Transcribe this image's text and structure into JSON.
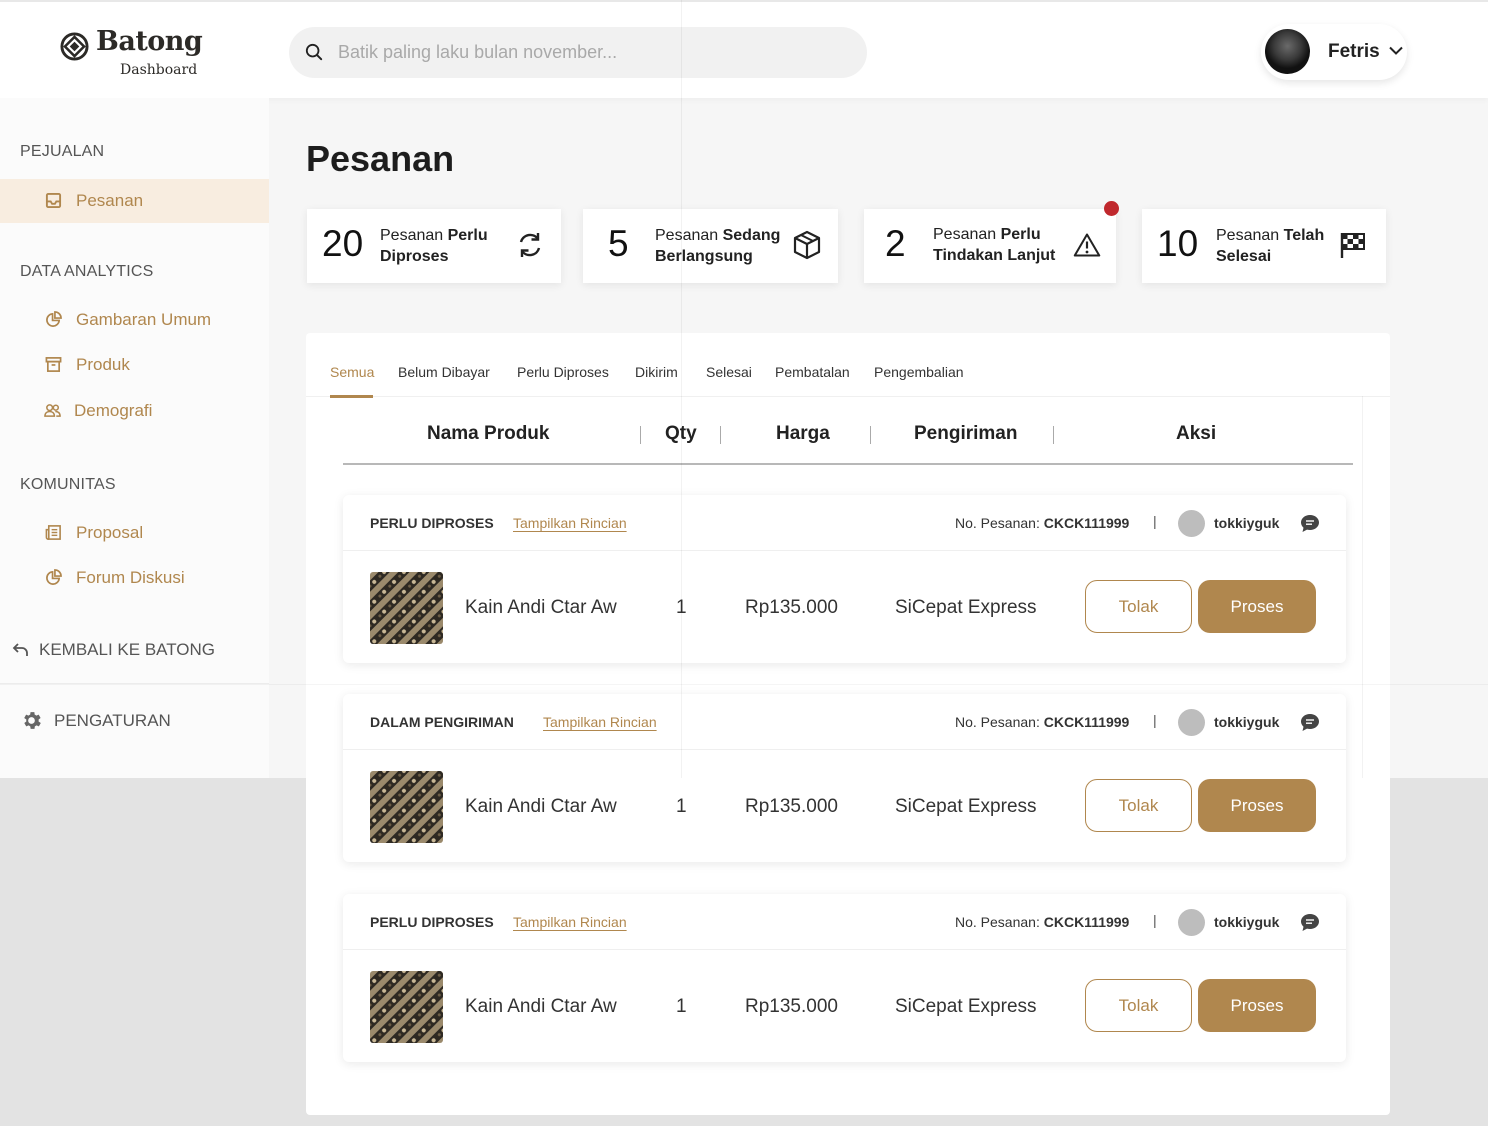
{
  "brand": {
    "name": "Batong",
    "subtitle": "Dashboard"
  },
  "search": {
    "placeholder": "Batik paling laku bulan november...",
    "value": ""
  },
  "user": {
    "name": "Fetris"
  },
  "sidebar": {
    "sections": [
      {
        "title": "PEJUALAN",
        "items": [
          {
            "label": "Pesanan",
            "icon": "inbox-icon",
            "active": true
          }
        ]
      },
      {
        "title": "DATA ANALYTICS",
        "items": [
          {
            "label": "Gambaran Umum",
            "icon": "pie-chart-icon"
          },
          {
            "label": "Produk",
            "icon": "archive-icon"
          },
          {
            "label": "Demografi",
            "icon": "users-icon"
          }
        ]
      },
      {
        "title": "KOMUNITAS",
        "items": [
          {
            "label": "Proposal",
            "icon": "newspaper-icon"
          },
          {
            "label": "Forum Diskusi",
            "icon": "pie-chart-icon"
          }
        ]
      }
    ],
    "back_label": "KEMBALI KE BATONG",
    "settings_label": "PENGATURAN"
  },
  "page": {
    "title": "Pesanan"
  },
  "stats": [
    {
      "number": "20",
      "line1_a": "Pesanan ",
      "line1_b": "Perlu",
      "line2": "Diproses",
      "icon": "refresh-icon"
    },
    {
      "number": "5",
      "line1_a": "Pesanan ",
      "line1_b": "Sedang",
      "line2": "Berlangsung",
      "icon": "box-icon"
    },
    {
      "number": "2",
      "line1_a": "Pesanan ",
      "line1_b": "Perlu",
      "line2": "Tindakan Lanjut",
      "icon": "warning-icon",
      "notification": true
    },
    {
      "number": "10",
      "line1_a": "Pesanan ",
      "line1_b": "Telah",
      "line2": "Selesai",
      "icon": "flag-checkered-icon"
    }
  ],
  "tabs": [
    "Semua",
    "Belum Dibayar",
    "Perlu Diproses",
    "Dikirim",
    "Selesai",
    "Pembatalan",
    "Pengembalian"
  ],
  "table": {
    "headers": {
      "product": "Nama Produk",
      "qty": "Qty",
      "price": "Harga",
      "shipping": "Pengiriman",
      "action": "Aksi"
    }
  },
  "orders": [
    {
      "status": "PERLU DIPROSES",
      "detail_link": "Tampilkan Rincian",
      "order_label": "No. Pesanan:",
      "order_no": "CKCK111999",
      "separator": "|",
      "customer": "tokkiyguk",
      "product": "Kain Andi Ctar Aw",
      "qty": "1",
      "price": "Rp135.000",
      "shipping": "SiCepat Express",
      "reject_label": "Tolak",
      "process_label": "Proses"
    },
    {
      "status": "DALAM PENGIRIMAN",
      "detail_link": "Tampilkan Rincian",
      "order_label": "No. Pesanan:",
      "order_no": "CKCK111999",
      "separator": "|",
      "customer": "tokkiyguk",
      "product": "Kain Andi Ctar Aw",
      "qty": "1",
      "price": "Rp135.000",
      "shipping": "SiCepat Express",
      "reject_label": "Tolak",
      "process_label": "Proses"
    },
    {
      "status": "PERLU DIPROSES",
      "detail_link": "Tampilkan Rincian",
      "order_label": "No. Pesanan:",
      "order_no": "CKCK111999",
      "separator": "|",
      "customer": "tokkiyguk",
      "product": "Kain Andi Ctar Aw",
      "qty": "1",
      "price": "Rp135.000",
      "shipping": "SiCepat Express",
      "reject_label": "Tolak",
      "process_label": "Proses"
    }
  ],
  "colors": {
    "accent": "#b0874e",
    "active_bg": "#f8ede0",
    "notification": "#c0282d"
  }
}
